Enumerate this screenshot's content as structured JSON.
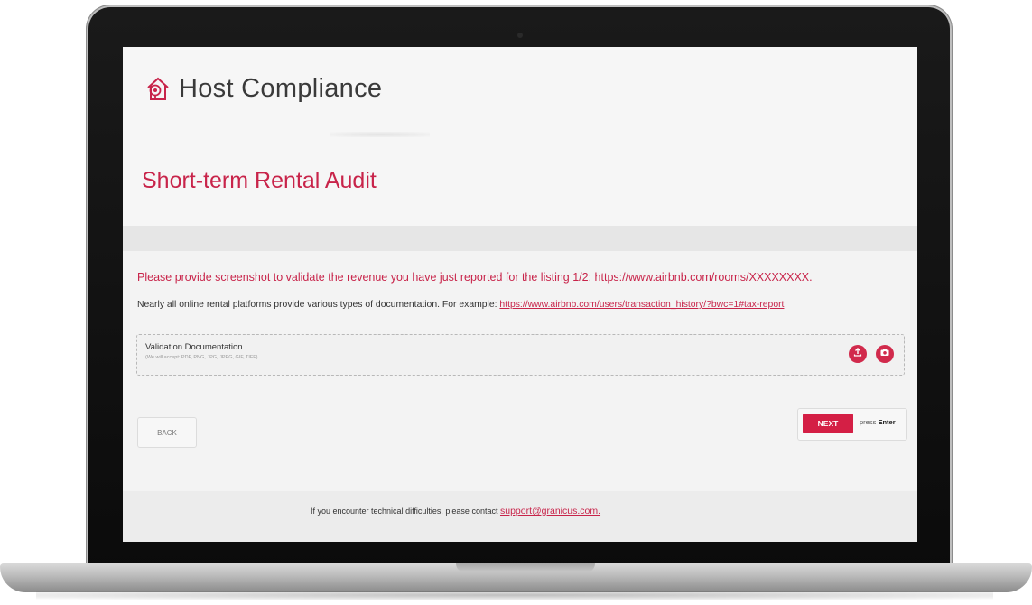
{
  "app": {
    "brand": "Host Compliance",
    "page_title": "Short-term Rental Audit"
  },
  "main": {
    "prompt": "Please provide screenshot to validate the revenue you have just reported for the listing 1/2: https://www.airbnb.com/rooms/XXXXXXXX.",
    "helper_text": "Nearly all online rental platforms provide various types of documentation. For example:",
    "helper_link": "https://www.airbnb.com/users/transaction_history/?bwc=1#tax-report",
    "upload": {
      "label": "Validation Documentation",
      "hint": "(We will accept: PDF, PNG, JPG, JPEG, GIF, TIFF)",
      "upload_icon": "upload-icon",
      "camera_icon": "camera-icon"
    }
  },
  "actions": {
    "back_label": "BACK",
    "next_label": "NEXT",
    "press_label": "press",
    "enter_label": "Enter"
  },
  "footer": {
    "text": "If you encounter technical difficulties, please contact",
    "support_link": "support@granicus.com."
  },
  "colors": {
    "accent": "#c8244a",
    "button": "#d41f45"
  }
}
